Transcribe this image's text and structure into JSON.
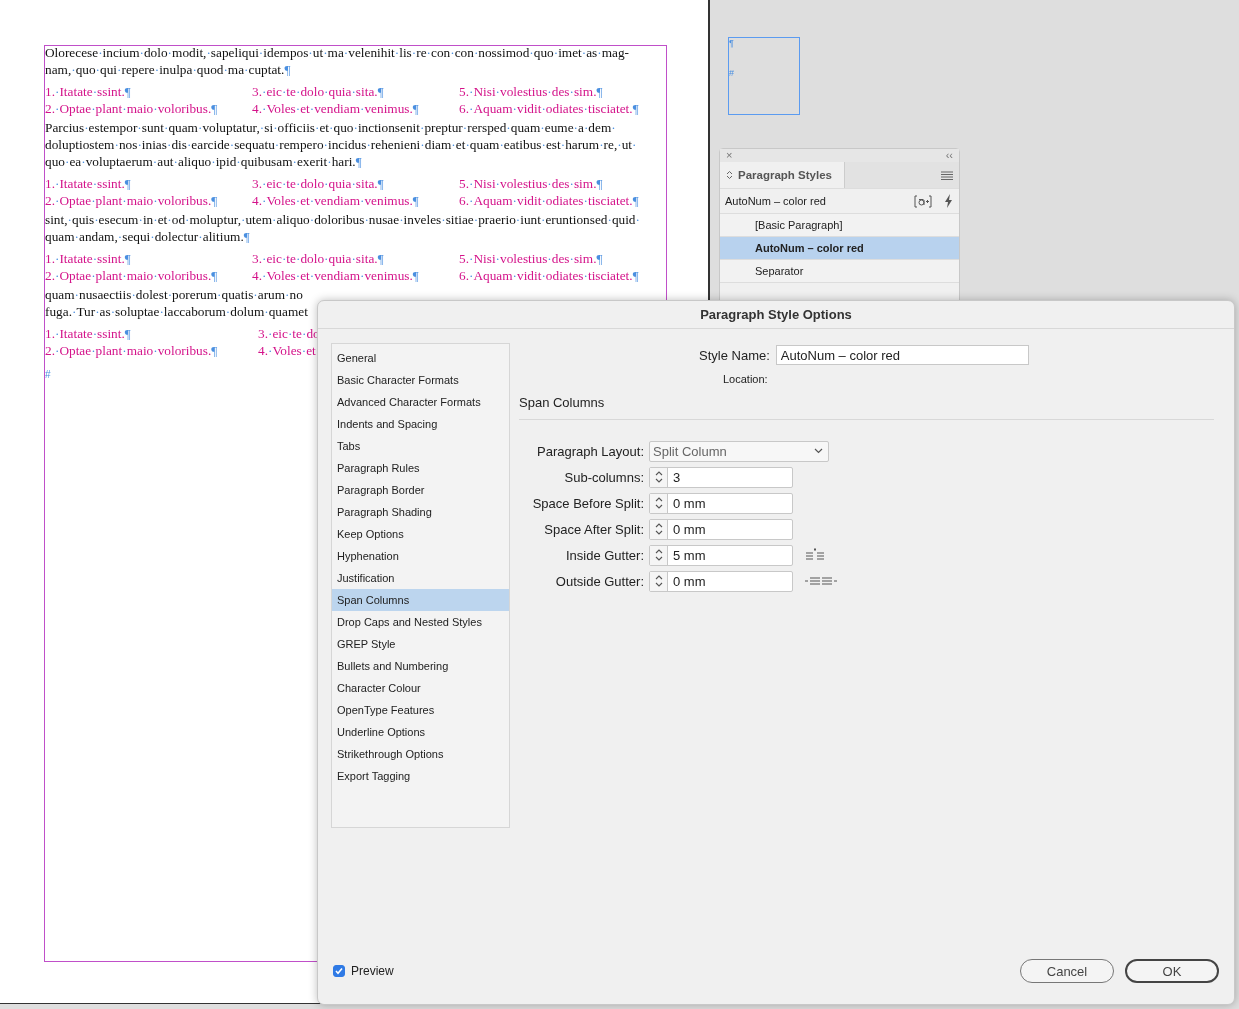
{
  "document": {
    "blocks": [
      {
        "kind": "paragraph",
        "lines": [
          "Olorecese·incium·dolo·modit,·sapeliqui·idempos·ut·ma·velenihit·lis·re·con·con·nossimod·quo·imet·as·mag-",
          "nam,·quo·qui·repere·inulpa·quod·ma·cuptat.¶"
        ]
      },
      {
        "kind": "list",
        "columns": [
          [
            "1.·Itatate·ssint.¶",
            "2.·Optae·plant·maio·voloribus.¶"
          ],
          [
            "3.·eic·te·dolo·quia·sita.¶",
            "4.·Voles·et·vendiam·venimus.¶"
          ],
          [
            "5.·Nisi·volestius·des·sim.¶",
            "6.·Aquam·vidit·odiates·tisciatet.¶"
          ]
        ]
      },
      {
        "kind": "paragraph",
        "lines": [
          "Parcius·estempor·sunt·quam·voluptatur,·si·officiis·et·quo·inctionsenit·preptur·rersped·quam·eume·a·dem·",
          "doluptiostem·nos·inias·dis·earcide·sequatu·rempero·incidus·rehenieni·diam·et·quam·eatibus·est·harum·re,·ut·",
          "quo·ea·voluptaerum·aut·aliquo·ipid·quibusam·exerit·hari.¶"
        ]
      },
      {
        "kind": "list",
        "columns": [
          [
            "1.·Itatate·ssint.¶",
            "2.·Optae·plant·maio·voloribus.¶"
          ],
          [
            "3.·eic·te·dolo·quia·sita.¶",
            "4.·Voles·et·vendiam·venimus.¶"
          ],
          [
            "5.·Nisi·volestius·des·sim.¶",
            "6.·Aquam·vidit·odiates·tisciatet.¶"
          ]
        ]
      },
      {
        "kind": "paragraph",
        "lines": [
          "sint,·quis·esecum·in·et·od·moluptur,·utem·aliquo·doloribus·nusae·inveles·sitiae·praerio·iunt·eruntionsed·quid·",
          "quam·andam,·sequi·dolectur·alitium.¶"
        ]
      },
      {
        "kind": "list",
        "columns": [
          [
            "1.·Itatate·ssint.¶",
            "2.·Optae·plant·maio·voloribus.¶"
          ],
          [
            "3.·eic·te·dolo·quia·sita.¶",
            "4.·Voles·et·vendiam·venimus.¶"
          ],
          [
            "5.·Nisi·volestius·des·sim.¶",
            "6.·Aquam·vidit·odiates·tisciatet.¶"
          ]
        ]
      },
      {
        "kind": "paragraph",
        "lines": [
          "quam·nusaectiis·dolest·porerum·quatis·arum·no",
          "fuga.·Tur·as·soluptae·laccaborum·dolum·quamet"
        ]
      },
      {
        "kind": "list",
        "columns": [
          [
            "1.·Itatate·ssint.¶",
            "2.·Optae·plant·maio·voloribus.¶"
          ],
          [
            "3.·eic·te·do",
            "4.·Voles·et"
          ]
        ]
      }
    ],
    "end_mark": "#"
  },
  "frame_marks": [
    "¶",
    "#"
  ],
  "panel": {
    "close": "×",
    "collapse": "‹‹",
    "title": "Paragraph Styles",
    "current": "AutoNum – color red",
    "items": [
      {
        "label": "[Basic Paragraph]",
        "selected": false
      },
      {
        "label": "AutoNum – color red",
        "selected": true
      },
      {
        "label": "Separator",
        "selected": false
      }
    ]
  },
  "dialog": {
    "title": "Paragraph Style Options",
    "nav": [
      {
        "label": "General",
        "selected": false
      },
      {
        "label": "Basic Character Formats",
        "selected": false
      },
      {
        "label": "Advanced Character Formats",
        "selected": false
      },
      {
        "label": "Indents and Spacing",
        "selected": false
      },
      {
        "label": "Tabs",
        "selected": false
      },
      {
        "label": "Paragraph Rules",
        "selected": false
      },
      {
        "label": "Paragraph Border",
        "selected": false
      },
      {
        "label": "Paragraph Shading",
        "selected": false
      },
      {
        "label": "Keep Options",
        "selected": false
      },
      {
        "label": "Hyphenation",
        "selected": false
      },
      {
        "label": "Justification",
        "selected": false
      },
      {
        "label": "Span Columns",
        "selected": true
      },
      {
        "label": "Drop Caps and Nested Styles",
        "selected": false
      },
      {
        "label": "GREP Style",
        "selected": false
      },
      {
        "label": "Bullets and Numbering",
        "selected": false
      },
      {
        "label": "Character Colour",
        "selected": false
      },
      {
        "label": "OpenType Features",
        "selected": false
      },
      {
        "label": "Underline Options",
        "selected": false
      },
      {
        "label": "Strikethrough Options",
        "selected": false
      },
      {
        "label": "Export Tagging",
        "selected": false
      }
    ],
    "style_name": {
      "label": "Style Name:",
      "value": "AutoNum – color red"
    },
    "location_label": "Location:",
    "section": "Span Columns",
    "fields": [
      {
        "kind": "dropdown",
        "label": "Paragraph Layout:",
        "value": "Split Column"
      },
      {
        "kind": "spinner",
        "label": "Sub-columns:",
        "value": "3"
      },
      {
        "kind": "spinner",
        "label": "Space Before Split:",
        "value": "0 mm"
      },
      {
        "kind": "spinner",
        "label": "Space After Split:",
        "value": "0 mm"
      },
      {
        "kind": "spinner",
        "label": "Inside Gutter:",
        "value": "5 mm",
        "gutter": {
          "kind": "inside"
        }
      },
      {
        "kind": "spinner",
        "label": "Outside Gutter:",
        "value": "0 mm",
        "gutter": {
          "kind": "outside"
        }
      }
    ],
    "preview": {
      "label": "Preview",
      "checked": true
    },
    "buttons": [
      {
        "label": "Cancel",
        "default": false
      },
      {
        "label": "OK",
        "default": true
      }
    ]
  }
}
